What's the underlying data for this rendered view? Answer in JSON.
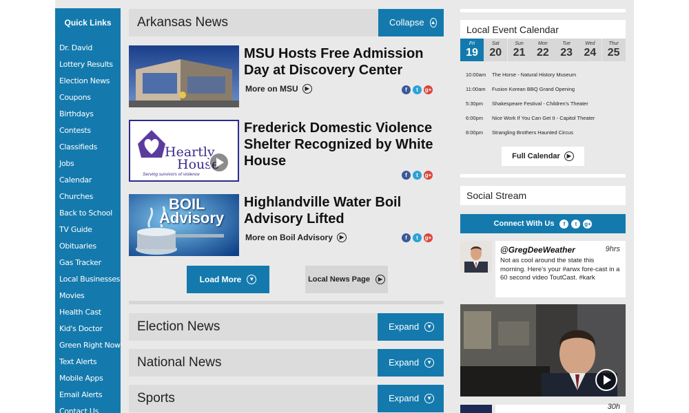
{
  "quick_links": {
    "title": "Quick Links",
    "items": [
      "Dr. David",
      "Lottery Results",
      "Election News",
      "Coupons",
      "Birthdays",
      "Contests",
      "Classifieds",
      "Jobs",
      "Calendar",
      "Churches",
      "Back to School",
      "TV Guide",
      "Obituaries",
      "Gas Tracker",
      "Local Businesses",
      "Movies",
      "Health Cast",
      "Kid's Doctor",
      "Green Right Now",
      "Text Alerts",
      "Mobile Apps",
      "Email Alerts",
      "Contact Us"
    ]
  },
  "arkansas_news": {
    "title": "Arkansas News",
    "collapse_label": "Collapse",
    "stories": [
      {
        "title": "MSU Hosts Free Admission Day at Discovery Center",
        "more": "More on MSU"
      },
      {
        "title": "Frederick Domestic Violence Shelter Recognized by White House",
        "more": "",
        "thumb_text_1": "Heartly",
        "thumb_text_2": "House",
        "thumb_caption": "Serving survivors of violence"
      },
      {
        "title": "Highlandville Water Boil Advisory Lifted",
        "more": "More on Boil Advisory",
        "thumb_text_1": "BOIL",
        "thumb_text_2": "Advisory"
      }
    ],
    "load_more": "Load More",
    "local_news_page": "Local News Page"
  },
  "collapsed_sections": [
    {
      "title": "Election News",
      "button": "Expand"
    },
    {
      "title": "National News",
      "button": "Expand"
    },
    {
      "title": "Sports",
      "button": "Expand"
    }
  ],
  "calendar": {
    "title": "Local Event Calendar",
    "days": [
      {
        "name": "Fri",
        "num": "19",
        "active": true
      },
      {
        "name": "Sat",
        "num": "20"
      },
      {
        "name": "Sun",
        "num": "21"
      },
      {
        "name": "Mon",
        "num": "22"
      },
      {
        "name": "Tue",
        "num": "23"
      },
      {
        "name": "Wed",
        "num": "24"
      },
      {
        "name": "Thur",
        "num": "25"
      }
    ],
    "events": [
      {
        "time": "10:00am",
        "name": "The Horse - Natural History Museum"
      },
      {
        "time": "11:00am",
        "name": "Fusion Korean BBQ Grand Opening"
      },
      {
        "time": "5:30pm",
        "name": "Shakespeare Festival - Children's Theater"
      },
      {
        "time": "6:00pm",
        "name": "Nice Work If You Can Get It - Capitol Theater"
      },
      {
        "time": "8:00pm",
        "name": "Strangling Brothers Haunted Circus"
      }
    ],
    "full_calendar": "Full Calendar"
  },
  "social": {
    "title": "Social Stream",
    "connect": "Connect With Us",
    "tweet": {
      "handle": "@GregDeeWeather",
      "time": "9hrs",
      "text": "Not as cool around the state this morning. Here's your #arwx fore-cast in a 60 second video ToutCast. #kark"
    },
    "next_time": "30h"
  },
  "colors": {
    "accent": "#147aad",
    "panel": "#dcdcdc",
    "page": "#e9e9e9"
  }
}
